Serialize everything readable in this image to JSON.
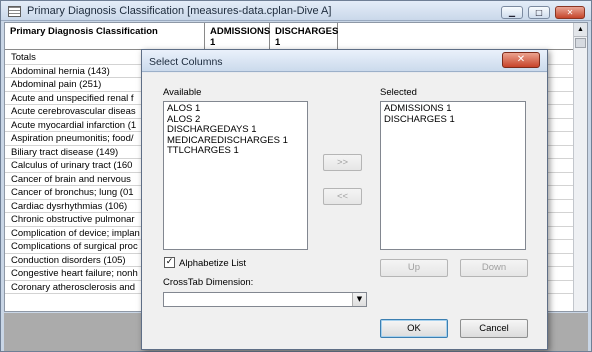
{
  "window": {
    "title": "Primary Diagnosis Classification [measures-data.cplan-Dive A]",
    "minimize_glyph": "▁",
    "maximize_glyph": "□",
    "close_glyph": "✕"
  },
  "grid": {
    "headers": [
      "Primary Diagnosis Classification",
      "ADMISSIONS\n1",
      "DISCHARGES\n1"
    ],
    "rows": [
      "Totals",
      "Abdominal hernia (143)",
      "Abdominal pain (251)",
      "Acute and unspecified renal f",
      "Acute cerebrovascular diseas",
      "Acute myocardial infarction (1",
      "Aspiration pneumonitis; food/",
      "Biliary tract disease (149)",
      "Calculus of urinary tract (160",
      "Cancer of brain and nervous",
      "Cancer of bronchus; lung (01",
      "Cardiac dysrhythmias (106)",
      "Chronic obstructive pulmonar",
      "Complication of device; implan",
      "Complications of surgical proc",
      "Conduction disorders (105)",
      "Congestive heart failure; nonh",
      "Coronary atherosclerosis and"
    ]
  },
  "dialog": {
    "title": "Select Columns",
    "close_glyph": "✕",
    "available_label": "Available",
    "available_items": [
      "ALOS 1",
      "ALOS 2",
      "DISCHARGEDAYS 1",
      "MEDICAREDISCHARGES 1",
      "TTLCHARGES 1"
    ],
    "selected_label": "Selected",
    "selected_items": [
      "ADMISSIONS 1",
      "DISCHARGES 1"
    ],
    "add_button": ">>",
    "remove_button": "<<",
    "alphabetize_label": "Alphabetize List",
    "alphabetize_checked": "✓",
    "crosstab_label": "CrossTab Dimension:",
    "crosstab_value": "",
    "combo_arrow": "▼",
    "up_button": "Up",
    "down_button": "Down",
    "ok_button": "OK",
    "cancel_button": "Cancel"
  }
}
